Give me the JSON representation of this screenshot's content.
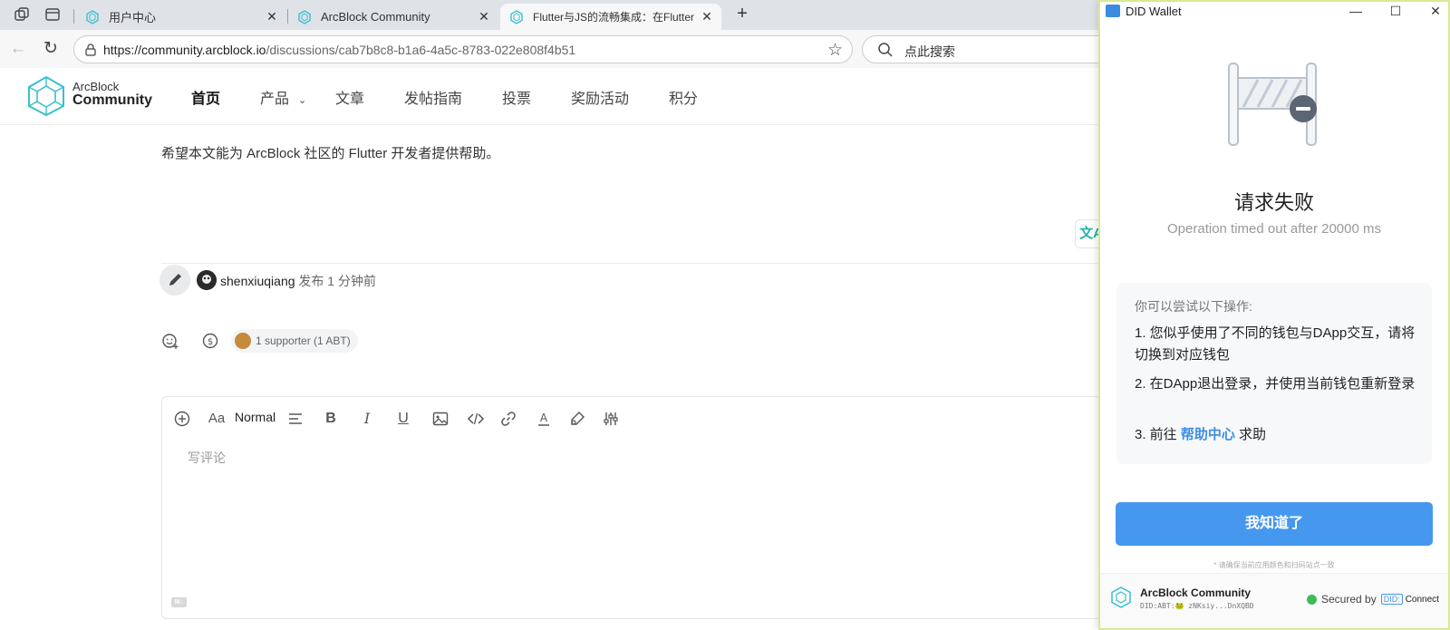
{
  "browser": {
    "tabs": [
      {
        "title": "用户中心",
        "active": false
      },
      {
        "title": "ArcBlock Community",
        "active": false
      },
      {
        "title": "Flutter与JS的流畅集成：在Flutter",
        "active": true
      }
    ],
    "url_host": "https://community.arcblock.io",
    "url_path": "/discussions/cab7b8c8-b1a6-4a5c-8783-022e808f4b51",
    "search_placeholder": "点此搜索"
  },
  "site": {
    "logo_line1": "ArcBlock",
    "logo_line2": "Community",
    "nav": [
      {
        "label": "首页",
        "active": true
      },
      {
        "label": "产品",
        "has_caret": true
      },
      {
        "label": "文章"
      },
      {
        "label": "发帖指南"
      },
      {
        "label": "投票"
      },
      {
        "label": "奖励活动"
      },
      {
        "label": "积分"
      }
    ]
  },
  "post": {
    "body_text": "希望本文能为 ArcBlock 社区的 Flutter 开发者提供帮助。",
    "author": "shenxiuqiang",
    "published_label": "发布 1 分钟前",
    "supporters_label": "1 supporter (1 ABT)"
  },
  "editor": {
    "format_label": "Normal",
    "placeholder": "写评论",
    "md_badge": "M↓"
  },
  "wallet": {
    "window_title": "DID Wallet",
    "error_title": "请求失败",
    "error_detail": "Operation timed out after 20000 ms",
    "tips_heading": "你可以尝试以下操作:",
    "tip1": "1. 您似乎使用了不同的钱包与DApp交互，请将切换到对应钱包",
    "tip2": "2. 在DApp退出登录，并使用当前钱包重新登录",
    "tip3_prefix": "3. 前往 ",
    "tip3_link": "帮助中心",
    "tip3_suffix": " 求助",
    "ok_button": "我知道了",
    "footer_note": "* 请确保当前应用颜色和扫码站点一致",
    "app_name": "ArcBlock Community",
    "app_did": "DID:ABT:🐸 zNKsiy...DnXQBD",
    "secured_by": "Secured by",
    "did_badge": "DID:",
    "connect": "Connect",
    "colors": {
      "primary": "#4598ee",
      "border": "#d9ea8f"
    }
  },
  "icons": {
    "tab_actions": "workspaces-icon",
    "vertical_tabs": "vertical-tabs-icon",
    "favicon": "arcblock-favicon"
  }
}
